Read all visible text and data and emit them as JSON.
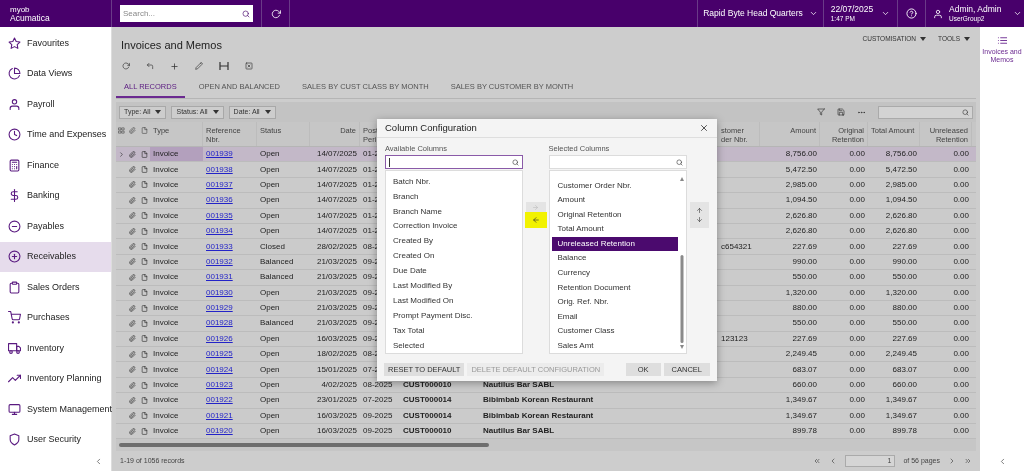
{
  "topbar": {
    "logo_top": "myob",
    "logo_bottom": "Acumatica",
    "search_placeholder": "Search...",
    "company": "Rapid Byte Head Quarters",
    "date": "22/07/2025",
    "time": "1:47 PM",
    "user_name": "Admin, Admin",
    "user_group": "UserGroup2"
  },
  "sidebar": {
    "items": [
      {
        "label": "Favourites",
        "kind": "star",
        "selected": false
      },
      {
        "label": "Data Views",
        "kind": "pie",
        "selected": false
      },
      {
        "label": "Payroll",
        "kind": "payroll",
        "selected": false
      },
      {
        "label": "Time and Expenses",
        "kind": "timer",
        "selected": false
      },
      {
        "label": "Finance",
        "kind": "finance",
        "selected": false
      },
      {
        "label": "Banking",
        "kind": "dollar",
        "selected": false
      },
      {
        "label": "Payables",
        "kind": "minus",
        "selected": false
      },
      {
        "label": "Receivables",
        "kind": "plus",
        "selected": true
      },
      {
        "label": "Sales Orders",
        "kind": "clipboard",
        "selected": false
      },
      {
        "label": "Purchases",
        "kind": "cart",
        "selected": false
      },
      {
        "label": "Inventory",
        "kind": "truck",
        "selected": false
      },
      {
        "label": "Inventory Planning",
        "kind": "trend",
        "selected": false
      },
      {
        "label": "System Management",
        "kind": "monitor",
        "selected": false
      },
      {
        "label": "User Security",
        "kind": "shield",
        "selected": false
      }
    ]
  },
  "page": {
    "title": "Invoices and Memos",
    "menus": [
      "CUSTOMISATION",
      "TOOLS"
    ]
  },
  "tabs": [
    {
      "label": "ALL RECORDS",
      "selected": true
    },
    {
      "label": "OPEN AND BALANCED",
      "selected": false
    },
    {
      "label": "SALES BY CUST CLASS BY MONTH",
      "selected": false
    },
    {
      "label": "SALES BY CUSTOMER BY MONTH",
      "selected": false
    }
  ],
  "filters": [
    "Type: All",
    "Status: All",
    "Date: All"
  ],
  "table": {
    "columns": {
      "type": "Type",
      "reference": "Reference\nNbr.",
      "status": "Status",
      "date": "Date",
      "post_period": "Post\nPeri",
      "customer_order": "stomer\nder Nbr.",
      "amount": "Amount",
      "original_retention": "Original\nRetention",
      "total_amount": "Total Amount",
      "unreleased_retention": "Unreleased\nRetention"
    },
    "rows": [
      {
        "selected": true,
        "type": "Invoice",
        "reference": "001939",
        "status": "Open",
        "date": "14/07/2025",
        "post_period": "01-2",
        "amount": "8,756.00",
        "original_retention": "0.00",
        "total_amount": "8,756.00",
        "unreleased_retention": "0.00"
      },
      {
        "selected": false,
        "type": "Invoice",
        "reference": "001938",
        "status": "Open",
        "date": "14/07/2025",
        "post_period": "01-2",
        "amount": "5,472.50",
        "original_retention": "0.00",
        "total_amount": "5,472.50",
        "unreleased_retention": "0.00"
      },
      {
        "selected": false,
        "type": "Invoice",
        "reference": "001937",
        "status": "Open",
        "date": "14/07/2025",
        "post_period": "01-2",
        "amount": "2,985.00",
        "original_retention": "0.00",
        "total_amount": "2,985.00",
        "unreleased_retention": "0.00"
      },
      {
        "selected": false,
        "type": "Invoice",
        "reference": "001936",
        "status": "Open",
        "date": "14/07/2025",
        "post_period": "01-2",
        "amount": "1,094.50",
        "original_retention": "0.00",
        "total_amount": "1,094.50",
        "unreleased_retention": "0.00"
      },
      {
        "selected": false,
        "type": "Invoice",
        "reference": "001935",
        "status": "Open",
        "date": "14/07/2025",
        "post_period": "01-2",
        "amount": "2,626.80",
        "original_retention": "0.00",
        "total_amount": "2,626.80",
        "unreleased_retention": "0.00"
      },
      {
        "selected": false,
        "type": "Invoice",
        "reference": "001934",
        "status": "Open",
        "date": "14/07/2025",
        "post_period": "01-2",
        "amount": "2,626.80",
        "original_retention": "0.00",
        "total_amount": "2,626.80",
        "unreleased_retention": "0.00"
      },
      {
        "selected": false,
        "type": "Invoice",
        "reference": "001933",
        "status": "Closed",
        "date": "28/02/2025",
        "post_period": "08-2",
        "customer_order": "c654321",
        "amount": "227.69",
        "original_retention": "0.00",
        "total_amount": "227.69",
        "unreleased_retention": "0.00"
      },
      {
        "selected": false,
        "type": "Invoice",
        "reference": "001932",
        "status": "Balanced",
        "date": "21/03/2025",
        "post_period": "09-2",
        "amount": "990.00",
        "original_retention": "0.00",
        "total_amount": "990.00",
        "unreleased_retention": "0.00"
      },
      {
        "selected": false,
        "type": "Invoice",
        "reference": "001931",
        "status": "Balanced",
        "date": "21/03/2025",
        "post_period": "09-2",
        "amount": "550.00",
        "original_retention": "0.00",
        "total_amount": "550.00",
        "unreleased_retention": "0.00"
      },
      {
        "selected": false,
        "type": "Invoice",
        "reference": "001930",
        "status": "Open",
        "date": "21/03/2025",
        "post_period": "09-2",
        "amount": "1,320.00",
        "original_retention": "0.00",
        "total_amount": "1,320.00",
        "unreleased_retention": "0.00"
      },
      {
        "selected": false,
        "type": "Invoice",
        "reference": "001929",
        "status": "Open",
        "date": "21/03/2025",
        "post_period": "09-2",
        "amount": "880.00",
        "original_retention": "0.00",
        "total_amount": "880.00",
        "unreleased_retention": "0.00"
      },
      {
        "selected": false,
        "type": "Invoice",
        "reference": "001928",
        "status": "Balanced",
        "date": "21/03/2025",
        "post_period": "09-2",
        "amount": "550.00",
        "original_retention": "0.00",
        "total_amount": "550.00",
        "unreleased_retention": "0.00"
      },
      {
        "selected": false,
        "type": "Invoice",
        "reference": "001926",
        "status": "Open",
        "date": "16/03/2025",
        "post_period": "09-2",
        "customer_order": "123123",
        "amount": "227.69",
        "original_retention": "0.00",
        "total_amount": "227.69",
        "unreleased_retention": "0.00"
      },
      {
        "selected": false,
        "type": "Invoice",
        "reference": "001925",
        "status": "Open",
        "date": "18/02/2025",
        "post_period": "08-2",
        "amount": "2,249.45",
        "original_retention": "0.00",
        "total_amount": "2,249.45",
        "unreleased_retention": "0.00"
      },
      {
        "selected": false,
        "type": "Invoice",
        "reference": "001924",
        "status": "Open",
        "date": "15/01/2025",
        "post_period": "07-2",
        "amount": "683.07",
        "original_retention": "0.00",
        "total_amount": "683.07",
        "unreleased_retention": "0.00"
      },
      {
        "selected": false,
        "type": "Invoice",
        "reference": "001923",
        "status": "Open",
        "date": "4/02/2025",
        "post_period": "08-2025",
        "customer": "CUST000010",
        "customer_name": "Nautilus Bar SABL",
        "amount": "660.00",
        "original_retention": "0.00",
        "total_amount": "660.00",
        "unreleased_retention": "0.00"
      },
      {
        "selected": false,
        "type": "Invoice",
        "reference": "001922",
        "status": "Open",
        "date": "23/01/2025",
        "post_period": "07-2025",
        "customer": "CUST000014",
        "customer_name": "Bibimbab Korean Restaurant",
        "amount": "1,349.67",
        "original_retention": "0.00",
        "total_amount": "1,349.67",
        "unreleased_retention": "0.00"
      },
      {
        "selected": false,
        "type": "Invoice",
        "reference": "001921",
        "status": "Open",
        "date": "16/03/2025",
        "post_period": "09-2025",
        "customer": "CUST000014",
        "customer_name": "Bibimbab Korean Restaurant",
        "amount": "1,349.67",
        "original_retention": "0.00",
        "total_amount": "1,349.67",
        "unreleased_retention": "0.00"
      },
      {
        "selected": false,
        "type": "Invoice",
        "reference": "001920",
        "status": "Open",
        "date": "16/03/2025",
        "post_period": "09-2025",
        "customer": "CUST000010",
        "customer_name": "Nautilus Bar SABL",
        "amount": "899.78",
        "original_retention": "0.00",
        "total_amount": "899.78",
        "unreleased_retention": "0.00"
      }
    ]
  },
  "footer": {
    "records": "1-19 of 1056 records",
    "page": "1",
    "pages": "of 56 pages"
  },
  "right_panel": {
    "label": "Invoices and Memos"
  },
  "dialog": {
    "title": "Column Configuration",
    "available_label": "Available Columns",
    "selected_label": "Selected Columns",
    "available": [
      "Batch Nbr.",
      "Branch",
      "Branch Name",
      "Correction Invoice",
      "Created By",
      "Created On",
      "Due Date",
      "Last Modified By",
      "Last Modified On",
      "Prompt Payment Disc.",
      "Tax Total",
      "Selected"
    ],
    "selected_columns": [
      {
        "label": "Customer Order Nbr.",
        "selected": false
      },
      {
        "label": "Amount",
        "selected": false
      },
      {
        "label": "Original Retention",
        "selected": false
      },
      {
        "label": "Total Amount",
        "selected": false
      },
      {
        "label": "Unreleased Retention",
        "selected": true
      },
      {
        "label": "Balance",
        "selected": false
      },
      {
        "label": "Currency",
        "selected": false
      },
      {
        "label": "Retention Document",
        "selected": false
      },
      {
        "label": "Orig. Ref. Nbr.",
        "selected": false
      },
      {
        "label": "Email",
        "selected": false
      },
      {
        "label": "Customer Class",
        "selected": false
      },
      {
        "label": "Sales Amt",
        "selected": false
      }
    ],
    "move_right": {
      "disabled": true
    },
    "move_left": {
      "highlighted": true
    },
    "buttons_left": [
      {
        "label": "RESET TO DEFAULT",
        "disabled": false
      },
      {
        "label": "DELETE DEFAULT CONFIGURATION",
        "disabled": true
      }
    ],
    "buttons_right": [
      {
        "label": "OK",
        "disabled": false
      },
      {
        "label": "CANCEL",
        "disabled": false
      }
    ]
  }
}
